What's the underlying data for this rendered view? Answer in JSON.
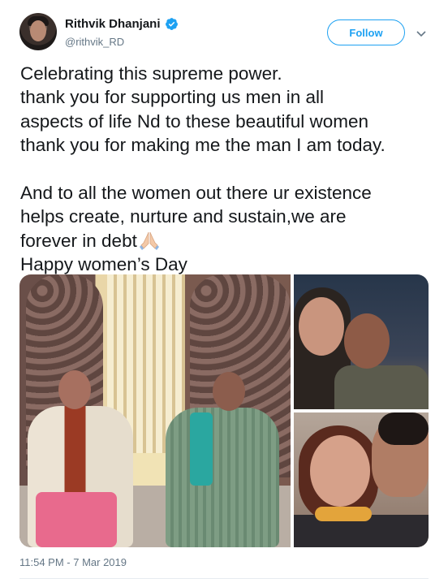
{
  "user": {
    "display_name": "Rithvik Dhanjani",
    "handle": "@rithvik_RD",
    "verified": true
  },
  "actions": {
    "follow_label": "Follow"
  },
  "tweet": {
    "lines": [
      "Celebrating this supreme power.",
      "thank you for supporting us men in all",
      "aspects of life Nd to these beautiful women",
      "thank you for making me the man I am today.",
      "",
      "And to all the women out there ur existence",
      "helps create, nurture and sustain,we are",
      "forever in debt",
      "Happy women’s Day"
    ],
    "emoji": "folded-hands-icon",
    "timestamp": "11:54 PM - 7 Mar 2019"
  },
  "colors": {
    "accent": "#1da1f2",
    "text": "#14171a",
    "secondary": "#657786"
  }
}
